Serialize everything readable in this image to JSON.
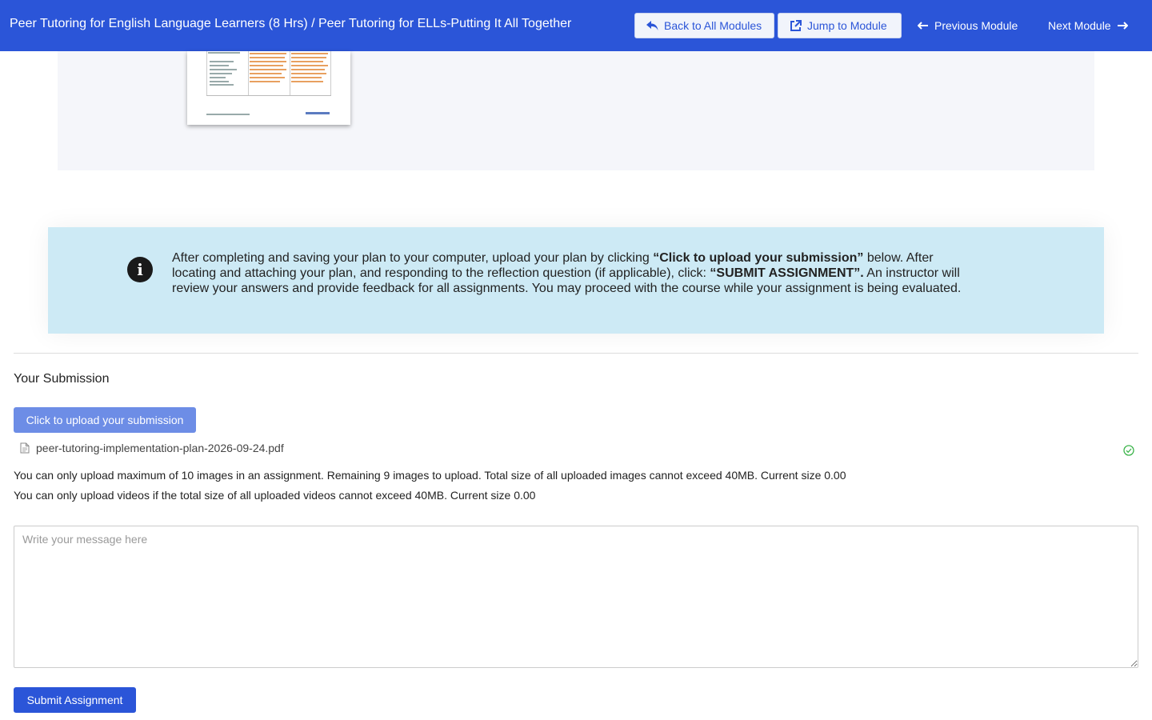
{
  "header": {
    "breadcrumb": "Peer Tutoring for English Language Learners (8 Hrs) / Peer Tutoring for ELLs-Putting It All Together",
    "back_label": "Back to All Modules",
    "jump_label": "Jump to Module",
    "prev_label": "Previous Module",
    "next_label": "Next Module"
  },
  "info": {
    "p1": "After completing and saving your plan to your computer, upload your plan by clicking ",
    "b1": "“Click to upload your submission”",
    "p2": " below.  After locating and attaching your plan, and responding to the reflection question (if applicable), click: ",
    "b2": "“SUBMIT ASSIGNMENT”.",
    "p3": "   An instructor will review your answers and provide feedback for all assignments.  You may proceed with the course while your assignment is being evaluated."
  },
  "submission": {
    "title": "Your Submission",
    "upload_label": "Click to upload your submission",
    "file_name": "peer-tutoring-implementation-plan-2026-09-24.pdf",
    "image_limit_text": "You can only upload maximum of 10 images in an assignment. Remaining 9 images to upload. Total size of all uploaded images cannot exceed 40MB. Current size 0.00",
    "video_limit_text": "You can only upload videos if the total size of all uploaded videos cannot exceed 40MB. Current size 0.00",
    "message_placeholder": "Write your message here",
    "submit_label": "Submit Assignment"
  },
  "colors": {
    "header_bg": "#2b55d8",
    "info_bg": "#cdeaf5",
    "upload_btn": "#6d8de6",
    "success": "#3cb44b"
  },
  "icons": [
    "reply-icon",
    "external-link-icon",
    "arrow-left-icon",
    "arrow-right-icon",
    "info-icon",
    "file-icon",
    "check-circle-icon"
  ]
}
